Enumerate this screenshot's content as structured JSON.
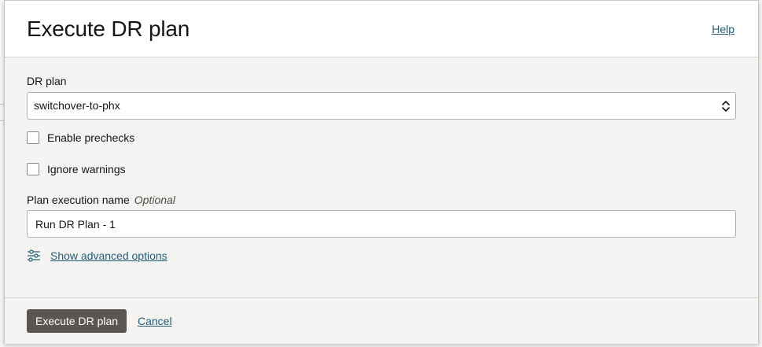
{
  "dialog": {
    "title": "Execute DR plan",
    "help_label": "Help"
  },
  "form": {
    "dr_plan_label": "DR plan",
    "dr_plan_selected": "switchover-to-phx",
    "enable_prechecks_label": "Enable prechecks",
    "enable_prechecks_checked": false,
    "ignore_warnings_label": "Ignore warnings",
    "ignore_warnings_checked": false,
    "plan_execution_name_label": "Plan execution name",
    "plan_execution_name_optional": "Optional",
    "plan_execution_name_value": "Run DR Plan - 1",
    "advanced_options_label": "Show advanced options"
  },
  "footer": {
    "execute_label": "Execute DR plan",
    "cancel_label": "Cancel"
  },
  "colors": {
    "primary_button": "#5d5550",
    "link": "#1e5d7a"
  }
}
